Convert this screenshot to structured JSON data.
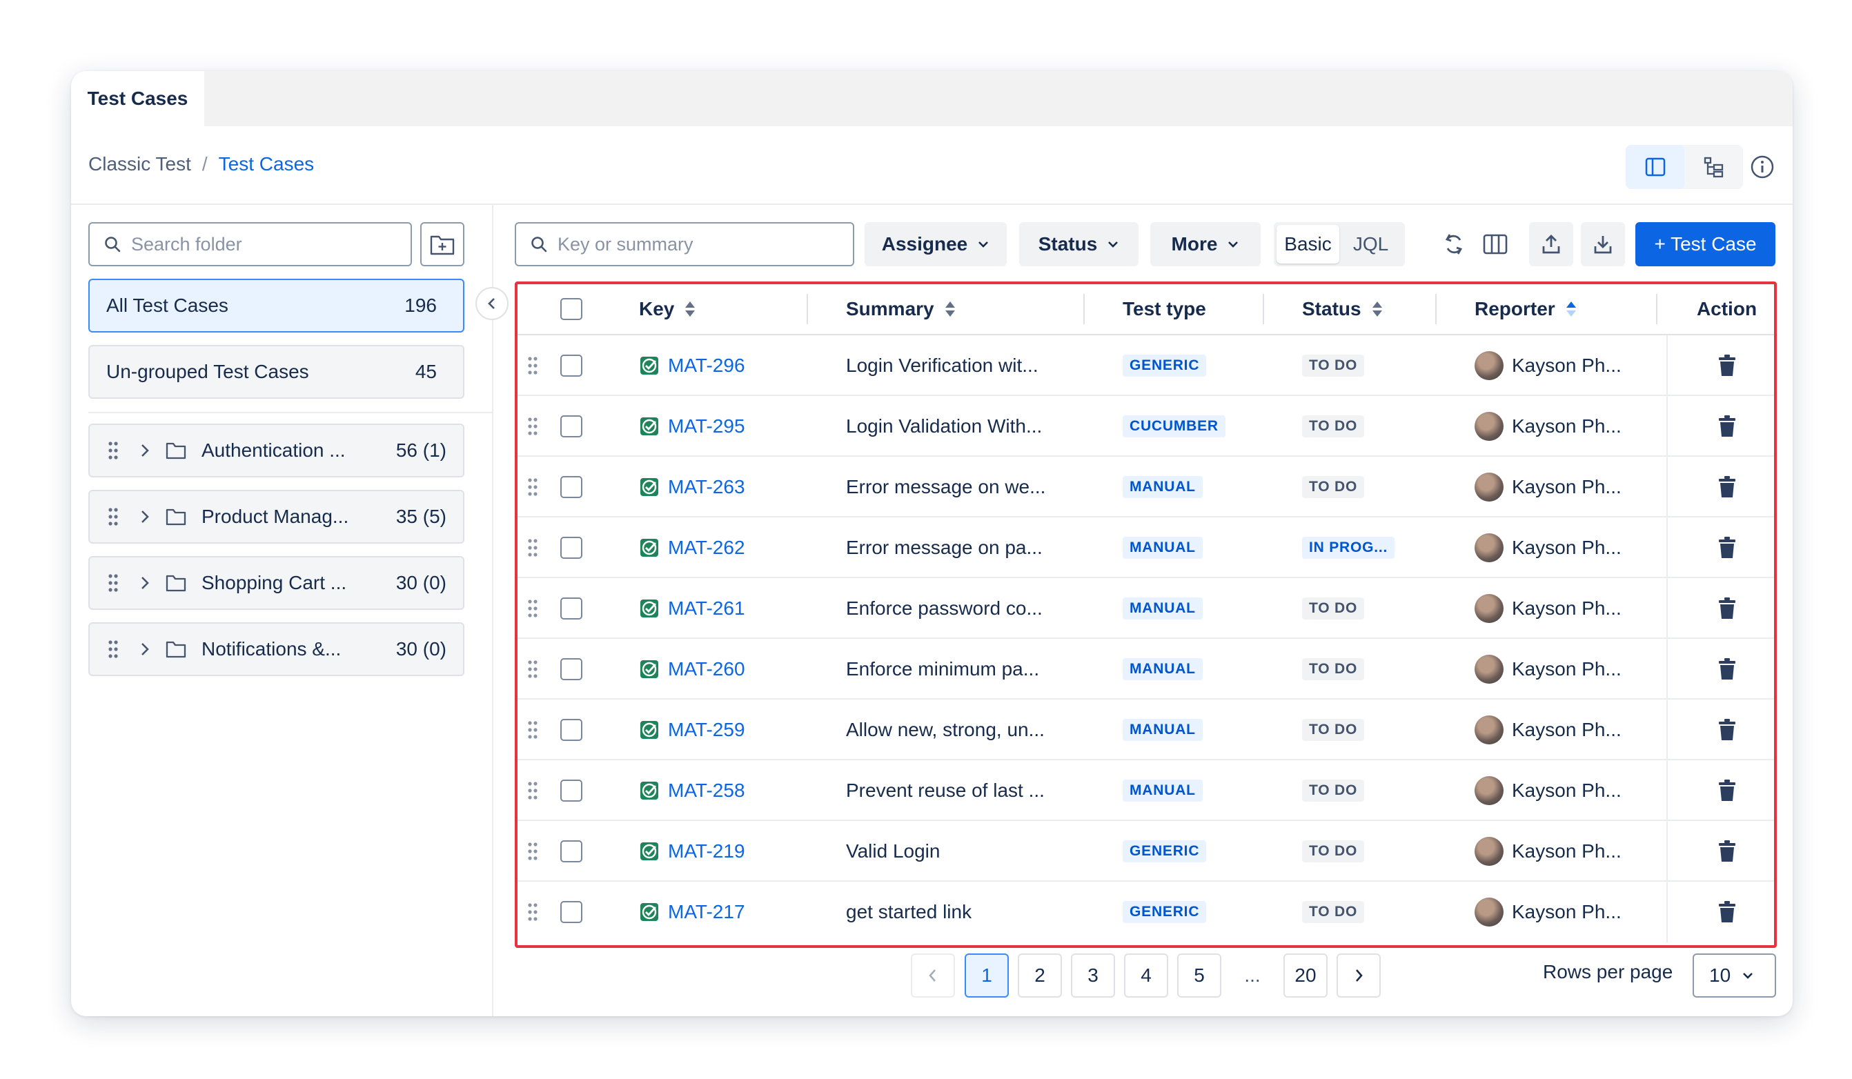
{
  "tabs": {
    "active": "Test Cases"
  },
  "breadcrumb": {
    "parent": "Classic Test",
    "separator": "/",
    "current": "Test Cases"
  },
  "sidebar": {
    "search_placeholder": "Search folder",
    "all": {
      "label": "All Test Cases",
      "count": "196"
    },
    "ungrouped": {
      "label": "Un-grouped Test Cases",
      "count": "45"
    },
    "folders": [
      {
        "name": "Authentication ...",
        "count": "56 (1)"
      },
      {
        "name": "Product Manag...",
        "count": "35 (5)"
      },
      {
        "name": "Shopping Cart ...",
        "count": "30 (0)"
      },
      {
        "name": "Notifications &...",
        "count": "30 (0)"
      }
    ]
  },
  "toolbar": {
    "search_placeholder": "Key or summary",
    "assignee": "Assignee",
    "status": "Status",
    "more": "More",
    "basic": "Basic",
    "jql": "JQL",
    "add_button": "+ Test Case"
  },
  "table": {
    "headers": {
      "key": "Key",
      "summary": "Summary",
      "test_type": "Test type",
      "status": "Status",
      "reporter": "Reporter",
      "action": "Action"
    },
    "rows": [
      {
        "key": "MAT-296",
        "summary": "Login Verification wit...",
        "type": "GENERIC",
        "status": "TO DO",
        "reporter": "Kayson Ph..."
      },
      {
        "key": "MAT-295",
        "summary": "Login Validation With...",
        "type": "CUCUMBER",
        "status": "TO DO",
        "reporter": "Kayson Ph..."
      },
      {
        "key": "MAT-263",
        "summary": "Error message on we...",
        "type": "MANUAL",
        "status": "TO DO",
        "reporter": "Kayson Ph..."
      },
      {
        "key": "MAT-262",
        "summary": "Error message on pa...",
        "type": "MANUAL",
        "status": "IN PROG...",
        "reporter": "Kayson Ph..."
      },
      {
        "key": "MAT-261",
        "summary": "Enforce password co...",
        "type": "MANUAL",
        "status": "TO DO",
        "reporter": "Kayson Ph..."
      },
      {
        "key": "MAT-260",
        "summary": "Enforce minimum pa...",
        "type": "MANUAL",
        "status": "TO DO",
        "reporter": "Kayson Ph..."
      },
      {
        "key": "MAT-259",
        "summary": "Allow new, strong, un...",
        "type": "MANUAL",
        "status": "TO DO",
        "reporter": "Kayson Ph..."
      },
      {
        "key": "MAT-258",
        "summary": "Prevent reuse of last ...",
        "type": "MANUAL",
        "status": "TO DO",
        "reporter": "Kayson Ph..."
      },
      {
        "key": "MAT-219",
        "summary": "Valid Login",
        "type": "GENERIC",
        "status": "TO DO",
        "reporter": "Kayson Ph..."
      },
      {
        "key": "MAT-217",
        "summary": "get started link",
        "type": "GENERIC",
        "status": "TO DO",
        "reporter": "Kayson Ph..."
      }
    ]
  },
  "pagination": {
    "pages": [
      "1",
      "2",
      "3",
      "4",
      "5"
    ],
    "ellipsis": "...",
    "last": "20",
    "current": "1",
    "rows_per_page_label": "Rows per page",
    "rows_per_page": "10"
  },
  "colors": {
    "primary": "#0c66e4",
    "highlight_border": "#e5333f",
    "key_icon": "#1f845a"
  }
}
